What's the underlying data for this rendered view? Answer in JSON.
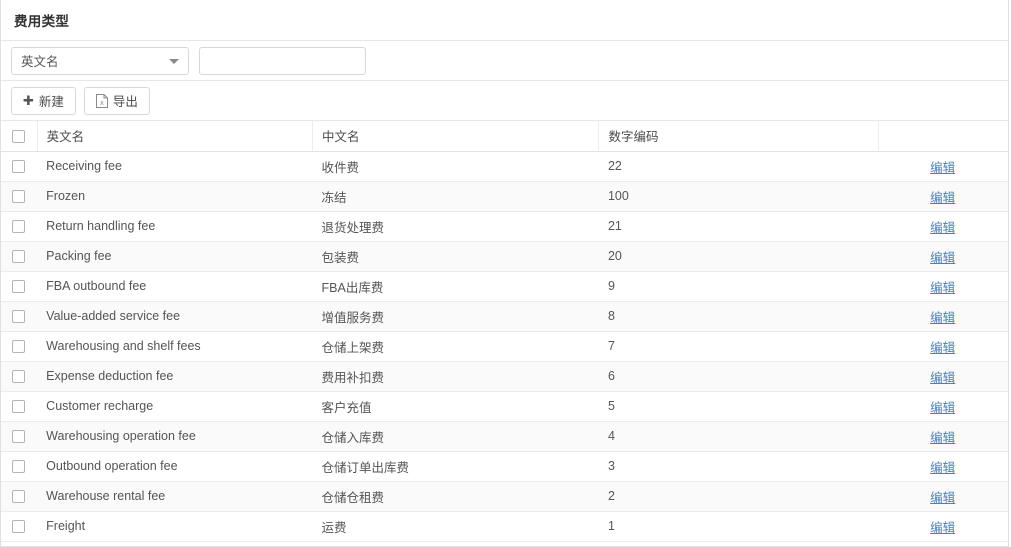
{
  "page": {
    "title": "费用类型"
  },
  "filter": {
    "select": {
      "value": "英文名",
      "caret_icon": "chevron-down-icon"
    },
    "keyword_input": {
      "value": "",
      "placeholder": ""
    }
  },
  "toolbar": {
    "new_label": "新建",
    "new_icon": "plus-icon",
    "export_label": "导出",
    "export_icon": "excel-file-icon"
  },
  "table": {
    "select_all_checkbox": "",
    "columns": [
      "英文名",
      "中文名",
      "数字编码",
      ""
    ],
    "op_label": "编辑",
    "rows": [
      {
        "en": "Receiving fee",
        "cn": "收件费",
        "code": "22",
        "op": "编辑"
      },
      {
        "en": "Frozen",
        "cn": "冻结",
        "code": "100",
        "op": "编辑"
      },
      {
        "en": "Return handling fee",
        "cn": "退货处理费",
        "code": "21",
        "op": "编辑"
      },
      {
        "en": "Packing fee",
        "cn": "包装费",
        "code": "20",
        "op": "编辑"
      },
      {
        "en": "FBA outbound fee",
        "cn": "FBA出库费",
        "code": "9",
        "op": "编辑"
      },
      {
        "en": "Value-added service fee",
        "cn": "增值服务费",
        "code": "8",
        "op": "编辑"
      },
      {
        "en": "Warehousing and shelf fees",
        "cn": "仓储上架费",
        "code": "7",
        "op": "编辑"
      },
      {
        "en": "Expense deduction fee",
        "cn": "费用补扣费",
        "code": "6",
        "op": "编辑"
      },
      {
        "en": "Customer recharge",
        "cn": "客户充值",
        "code": "5",
        "op": "编辑"
      },
      {
        "en": "Warehousing operation fee",
        "cn": "仓储入库费",
        "code": "4",
        "op": "编辑"
      },
      {
        "en": "Outbound operation fee",
        "cn": "仓储订单出库费",
        "code": "3",
        "op": "编辑"
      },
      {
        "en": "Warehouse rental fee",
        "cn": "仓储仓租费",
        "code": "2",
        "op": "编辑"
      },
      {
        "en": "Freight",
        "cn": "运费",
        "code": "1",
        "op": "编辑"
      }
    ]
  },
  "colors": {
    "link": "#4b7fbd",
    "border": "#e7e7e7",
    "stripe": "#fafafa",
    "text": "#555555"
  }
}
